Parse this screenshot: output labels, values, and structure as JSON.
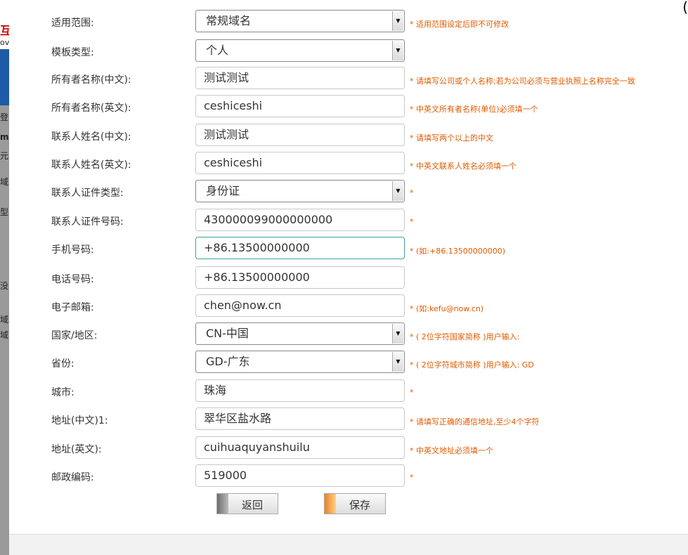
{
  "background": {
    "left_chars": [
      "互",
      "ov",
      "登",
      "m",
      "元",
      "域",
      "型",
      "没",
      "域",
      "域"
    ]
  },
  "close_glyph": "(",
  "form": {
    "rows": [
      {
        "label": "适用范围:",
        "value": "常规域名",
        "kind": "select",
        "note": "* 适用范围设定后即不可修改"
      },
      {
        "label": "模板类型:",
        "value": "个人",
        "kind": "select",
        "note": ""
      },
      {
        "label": "所有者名称(中文):",
        "value": "测试测试",
        "kind": "input",
        "note": "* 请填写公司或个人名称;若为公司必须与营业执照上名称完全一致"
      },
      {
        "label": "所有者名称(英文):",
        "value": "ceshiceshi",
        "kind": "input",
        "note": "* 中英文所有者名称(单位)必须填一个"
      },
      {
        "label": "联系人姓名(中文):",
        "value": "测试测试",
        "kind": "input",
        "note": "* 请填写两个以上的中文"
      },
      {
        "label": "联系人姓名(英文):",
        "value": "ceshiceshi",
        "kind": "input",
        "note": "* 中英文联系人姓名必须填一个"
      },
      {
        "label": "联系人证件类型:",
        "value": "身份证",
        "kind": "select",
        "note": "*"
      },
      {
        "label": "联系人证件号码:",
        "value": "430000099000000000",
        "kind": "input",
        "note": "*"
      },
      {
        "label": "手机号码:",
        "value": "+86.13500000000",
        "kind": "input",
        "note": "* (如:+86.13500000000)"
      },
      {
        "label": "电话号码:",
        "value": "+86.13500000000",
        "kind": "input",
        "note": ""
      },
      {
        "label": "电子邮箱:",
        "value": "chen@now.cn",
        "kind": "input",
        "note": "* (如:kefu@now.cn)"
      },
      {
        "label": "国家/地区:",
        "value": "CN-中国",
        "kind": "select",
        "note": "* ( 2位字符国家简称 )用户输入:"
      },
      {
        "label": "省份:",
        "value": "GD-广东",
        "kind": "select",
        "note": "* ( 2位字符城市简称 )用户输入: GD"
      },
      {
        "label": "城市:",
        "value": "珠海",
        "kind": "input",
        "note": "*"
      },
      {
        "label": "地址(中文)1:",
        "value": "翠华区盐水路",
        "kind": "input",
        "note": "* 请填写正确的通信地址,至少4个字符"
      },
      {
        "label": "地址(英文):",
        "value": "cuihuaquyanshuilu",
        "kind": "input",
        "note": "* 中英文地址必须填一个"
      },
      {
        "label": "邮政编码:",
        "value": "519000",
        "kind": "input",
        "note": "*"
      }
    ]
  },
  "buttons": {
    "back": "返回",
    "save": "保存"
  },
  "colors": {
    "note": "#e05a00",
    "focus_border": "#41a196",
    "save_accent": "#f08020",
    "back_accent": "#8a8a8a"
  }
}
